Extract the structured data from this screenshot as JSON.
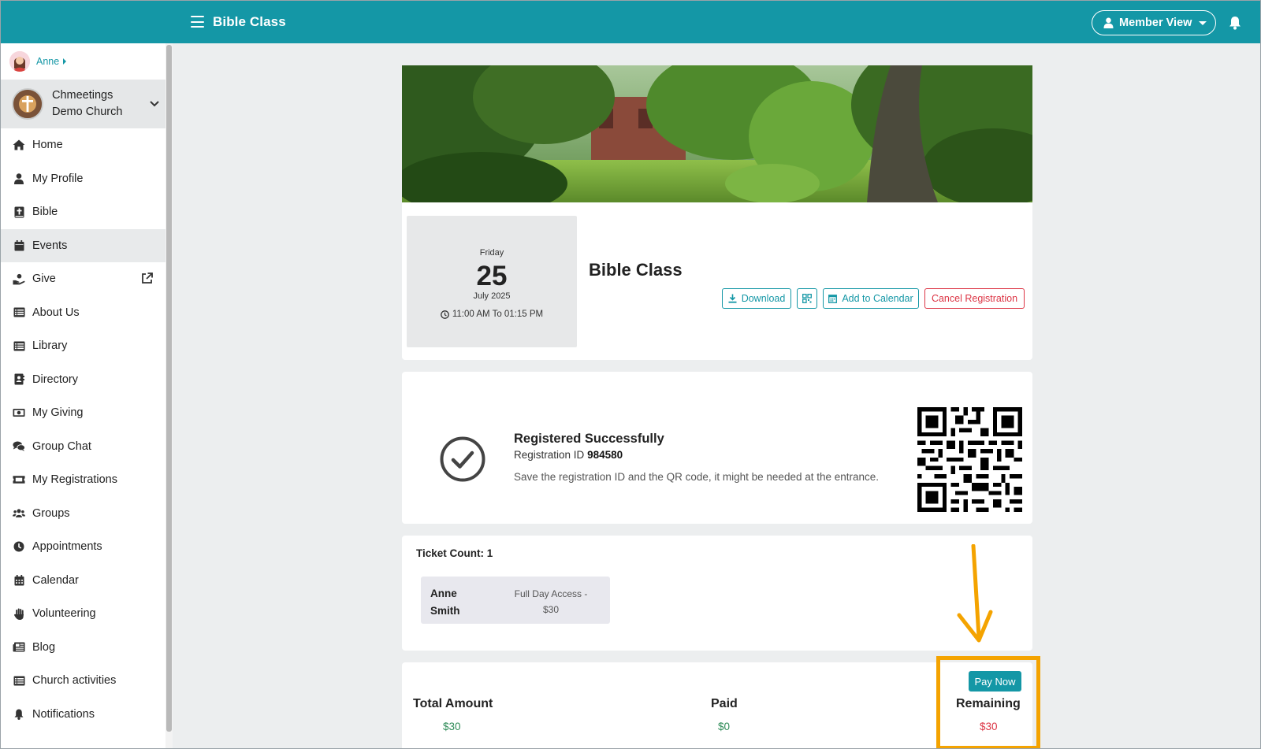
{
  "topbar": {
    "title": "Bible Class",
    "member_view_label": "Member View"
  },
  "sidebar": {
    "user_name": "Anne",
    "church_name": "Chmeetings Demo Church",
    "items": [
      {
        "label": "Home",
        "icon": "home-icon"
      },
      {
        "label": "My Profile",
        "icon": "user-icon"
      },
      {
        "label": "Bible",
        "icon": "bible-icon"
      },
      {
        "label": "Events",
        "icon": "calendar-icon",
        "active": true
      },
      {
        "label": "Give",
        "icon": "hand-give-icon",
        "external": true
      },
      {
        "label": "About Us",
        "icon": "list-icon"
      },
      {
        "label": "Library",
        "icon": "list-icon"
      },
      {
        "label": "Directory",
        "icon": "address-book-icon"
      },
      {
        "label": "My Giving",
        "icon": "money-icon"
      },
      {
        "label": "Group Chat",
        "icon": "chat-icon"
      },
      {
        "label": "My Registrations",
        "icon": "ticket-icon"
      },
      {
        "label": "Groups",
        "icon": "users-icon"
      },
      {
        "label": "Appointments",
        "icon": "clock-icon"
      },
      {
        "label": "Calendar",
        "icon": "calendar-grid-icon"
      },
      {
        "label": "Volunteering",
        "icon": "hand-icon"
      },
      {
        "label": "Blog",
        "icon": "newspaper-icon"
      },
      {
        "label": "Church activities",
        "icon": "list-icon"
      },
      {
        "label": "Notifications",
        "icon": "bell-icon"
      }
    ]
  },
  "event": {
    "day_of_week": "Friday",
    "day": "25",
    "month_year": "July  2025",
    "time_range": "11:00 AM To 01:15 PM",
    "title": "Bible Class",
    "buttons": {
      "download": "Download",
      "add_to_calendar": "Add to Calendar",
      "cancel_registration": "Cancel Registration"
    }
  },
  "registration": {
    "title": "Registered Successfully",
    "id_label": "Registration ID",
    "id_value": "984580",
    "note": "Save the registration ID and the QR code, it might be needed at the entrance."
  },
  "tickets": {
    "count_label": "Ticket Count: 1",
    "items": [
      {
        "name": "Anne Smith",
        "type": "Full Day Access - $30"
      }
    ]
  },
  "payment": {
    "total_label": "Total Amount",
    "total_value": "$30",
    "paid_label": "Paid",
    "paid_value": "$0",
    "remaining_label": "Remaining",
    "remaining_value": "$30",
    "pay_now_label": "Pay Now"
  },
  "colors": {
    "brand": "#1497a6",
    "success": "#2e8b57",
    "danger": "#dc3545",
    "annotation": "#f4a300"
  }
}
